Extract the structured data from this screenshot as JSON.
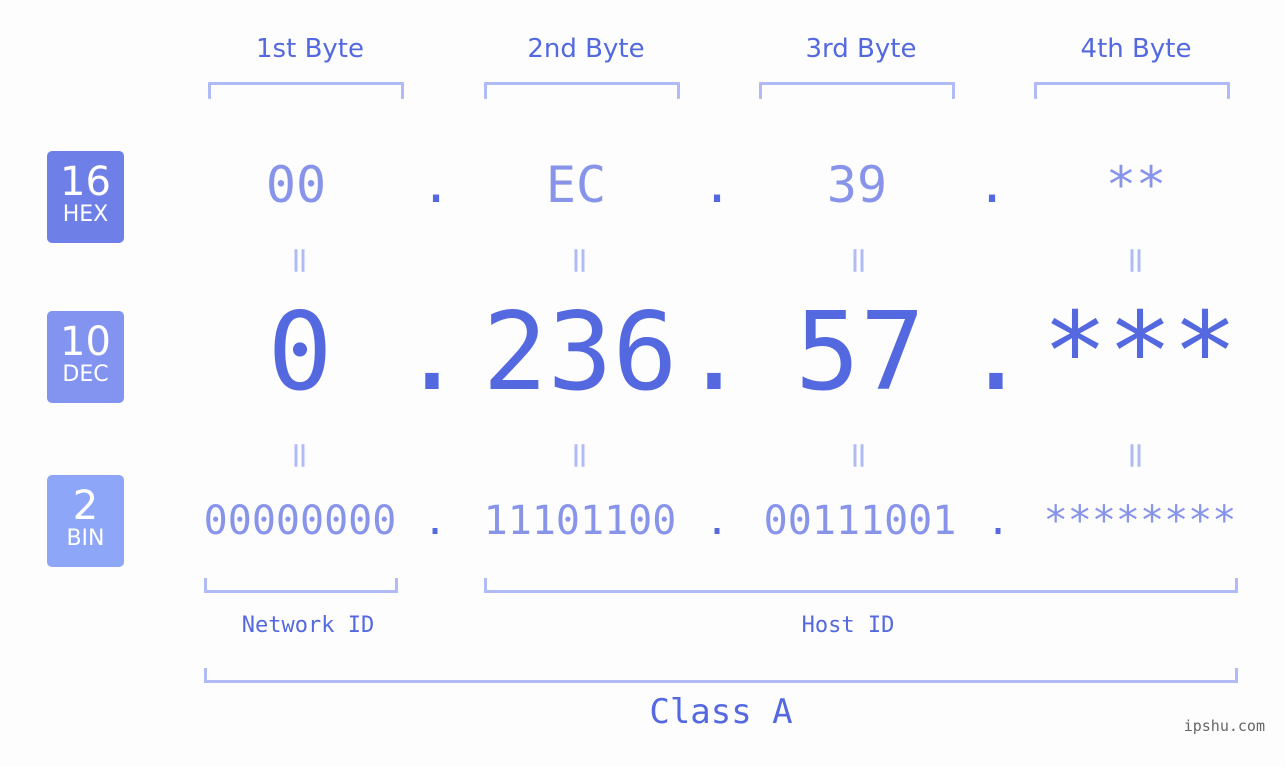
{
  "bytes": [
    "1st Byte",
    "2nd Byte",
    "3rd Byte",
    "4th Byte"
  ],
  "badges": [
    {
      "number": "16",
      "label": "HEX",
      "color": "#6f7fe8"
    },
    {
      "number": "10",
      "label": "DEC",
      "color": "#8393f0"
    },
    {
      "number": "2",
      "label": "BIN",
      "color": "#8ea6f8"
    }
  ],
  "hex": [
    "00",
    "EC",
    "39",
    "**"
  ],
  "dec": [
    "0",
    "236",
    "57",
    "***"
  ],
  "bin": [
    "00000000",
    "11101100",
    "00111001",
    "********"
  ],
  "separator": ".",
  "equals": "=",
  "network_label": "Network ID",
  "host_label": "Host ID",
  "class_label": "Class A",
  "watermark": "ipshu.com"
}
